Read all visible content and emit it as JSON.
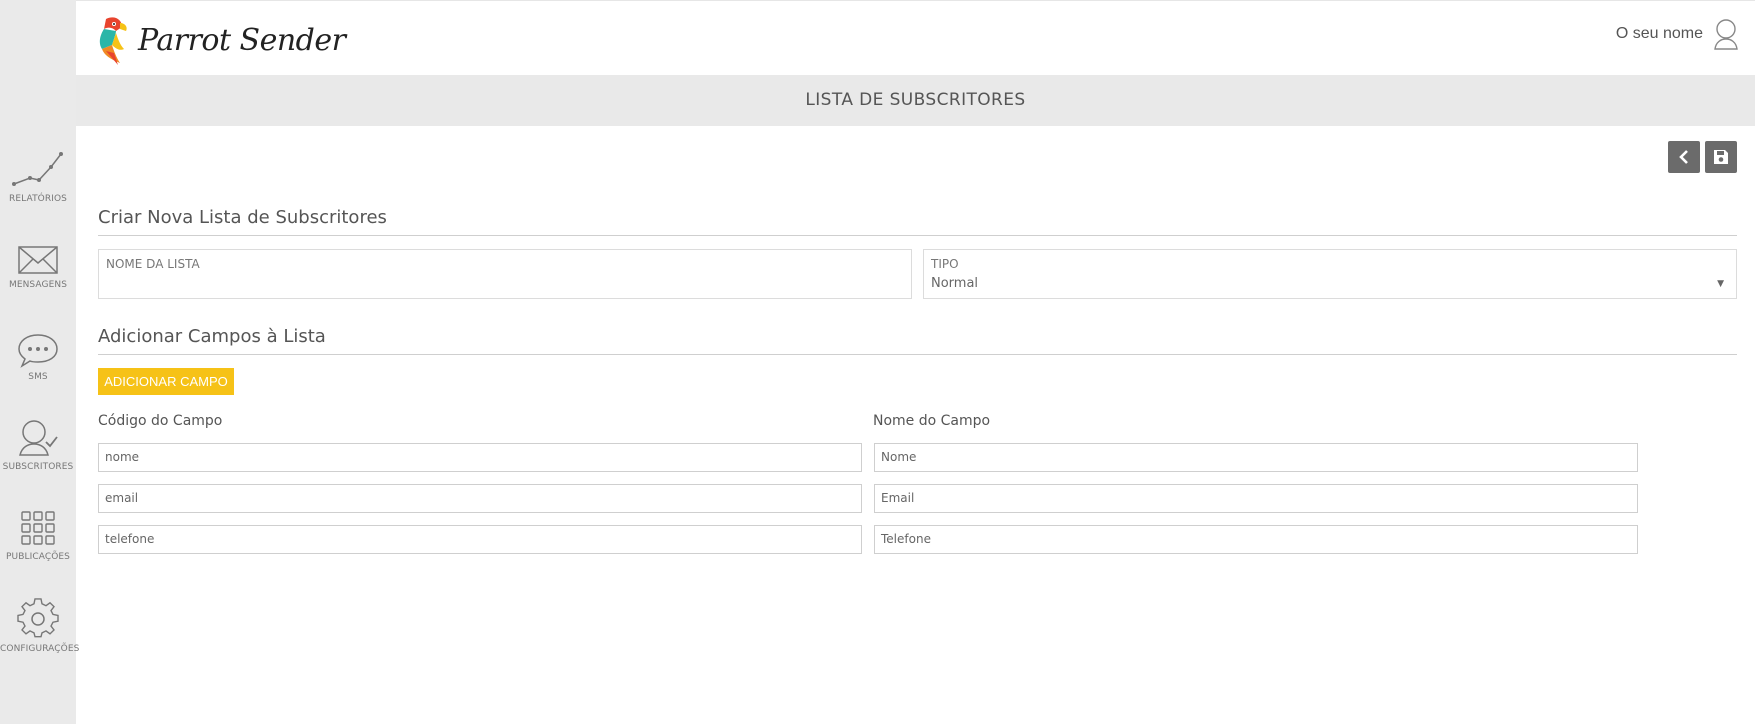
{
  "app": {
    "name": "Parrot Sender"
  },
  "user": {
    "name": "O seu nome"
  },
  "sidebar": {
    "items": [
      {
        "label": "RELATÓRIOS",
        "icon": "chart-line-icon"
      },
      {
        "label": "MENSAGENS",
        "icon": "envelope-icon"
      },
      {
        "label": "SMS",
        "icon": "speech-bubble-icon"
      },
      {
        "label": "SUBSCRITORES",
        "icon": "subscriber-icon"
      },
      {
        "label": "PUBLICAÇÕES",
        "icon": "grid-icon"
      },
      {
        "label": "CONFIGURAÇÕES",
        "icon": "gear-icon"
      }
    ]
  },
  "page": {
    "title": "LISTA DE SUBSCRITORES"
  },
  "toolbar": {
    "back_icon": "chevron-left-icon",
    "save_icon": "floppy-disk-icon"
  },
  "form": {
    "section1_title": "Criar Nova Lista de Subscritores",
    "list_name": {
      "label": "NOME DA LISTA",
      "value": ""
    },
    "type": {
      "label": "TIPO",
      "value": "Normal"
    },
    "section2_title": "Adicionar Campos à Lista",
    "add_field_button": "ADICIONAR CAMPO",
    "columns": {
      "code": "Código do Campo",
      "name": "Nome do Campo"
    },
    "fields": [
      {
        "code": "nome",
        "name": "Nome"
      },
      {
        "code": "email",
        "name": "Email"
      },
      {
        "code": "telefone",
        "name": "Telefone"
      }
    ]
  },
  "colors": {
    "accent": "#f6c217",
    "sidebar_bg": "#eaeaea",
    "title_bg": "#e9e9e9",
    "tool_button": "#6b6b6b"
  }
}
